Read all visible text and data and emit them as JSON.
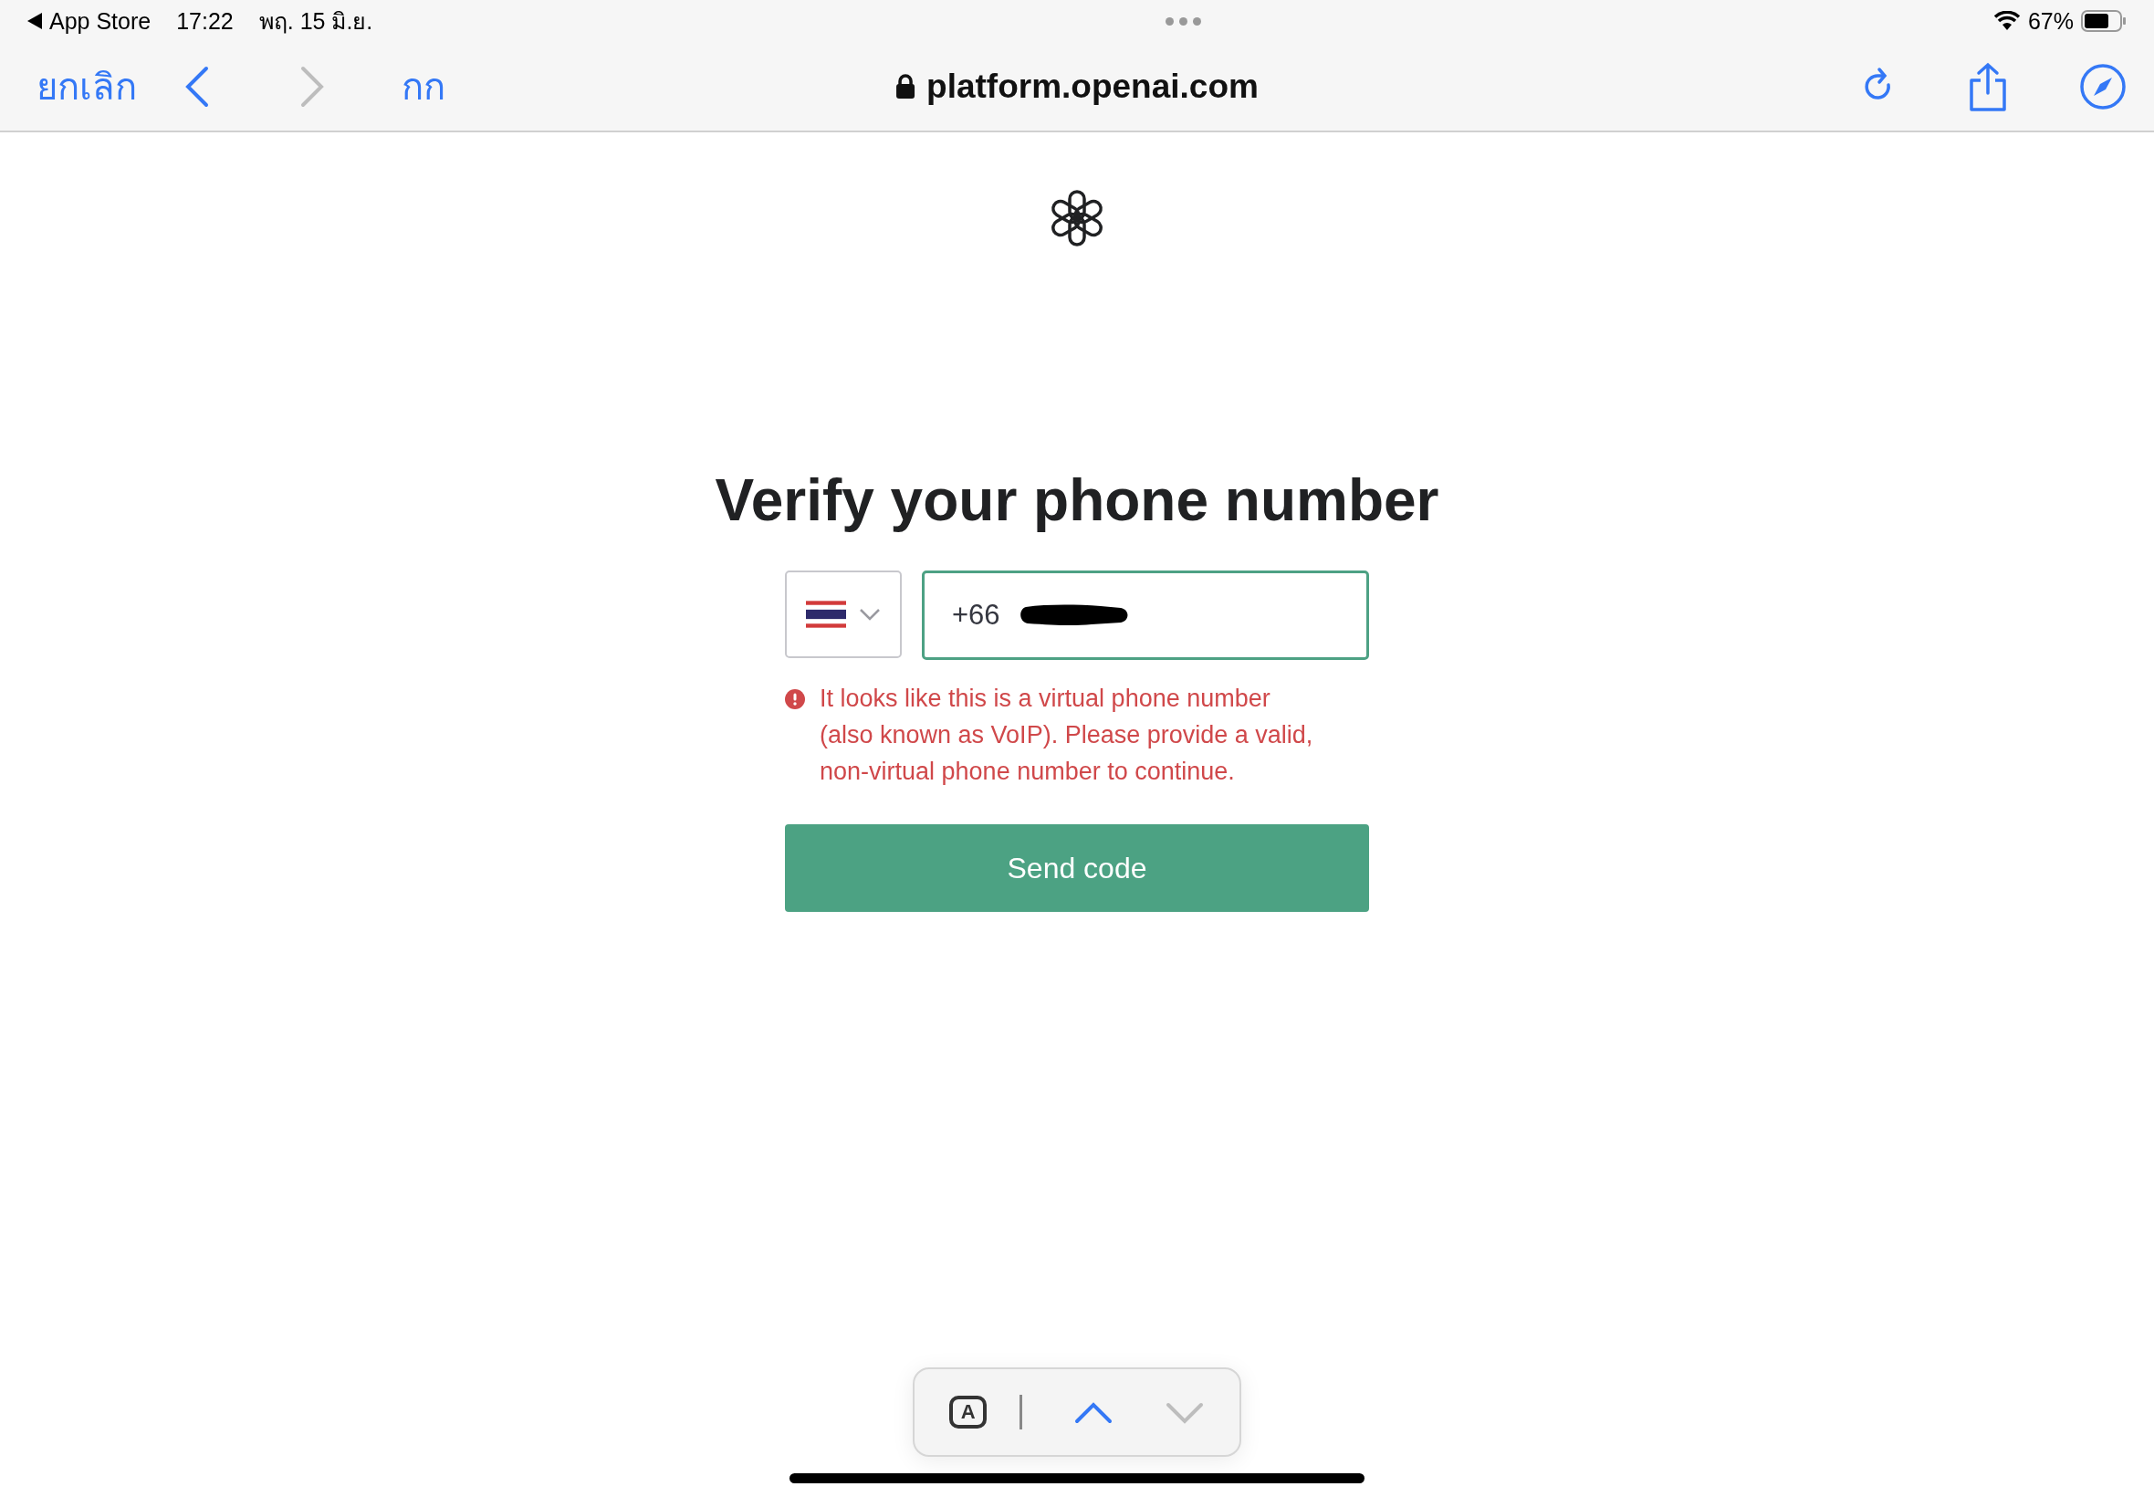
{
  "status_bar": {
    "back_app": "App Store",
    "time": "17:22",
    "date": "พฤ. 15 มิ.ย.",
    "battery": "67%"
  },
  "toolbar": {
    "cancel": "ยกเลิก",
    "nav_buttons": [
      {
        "kind": "back",
        "disabled": false
      },
      {
        "kind": "forward",
        "disabled": true
      }
    ],
    "text_size": "กก",
    "url": "platform.openai.com"
  },
  "page": {
    "heading": "Verify your phone number",
    "phone_field": {
      "value": "+66",
      "redacted": true,
      "focused": true
    },
    "error": "It looks like this is a virtual phone number (also known as VoIP). Please provide a valid, non-virtual phone number to continue.",
    "submit": "Send code"
  },
  "find_bar": {
    "autofill_key": "A",
    "arrows": [
      {
        "kind": "up",
        "disabled": false
      },
      {
        "kind": "down",
        "disabled": true
      }
    ]
  }
}
